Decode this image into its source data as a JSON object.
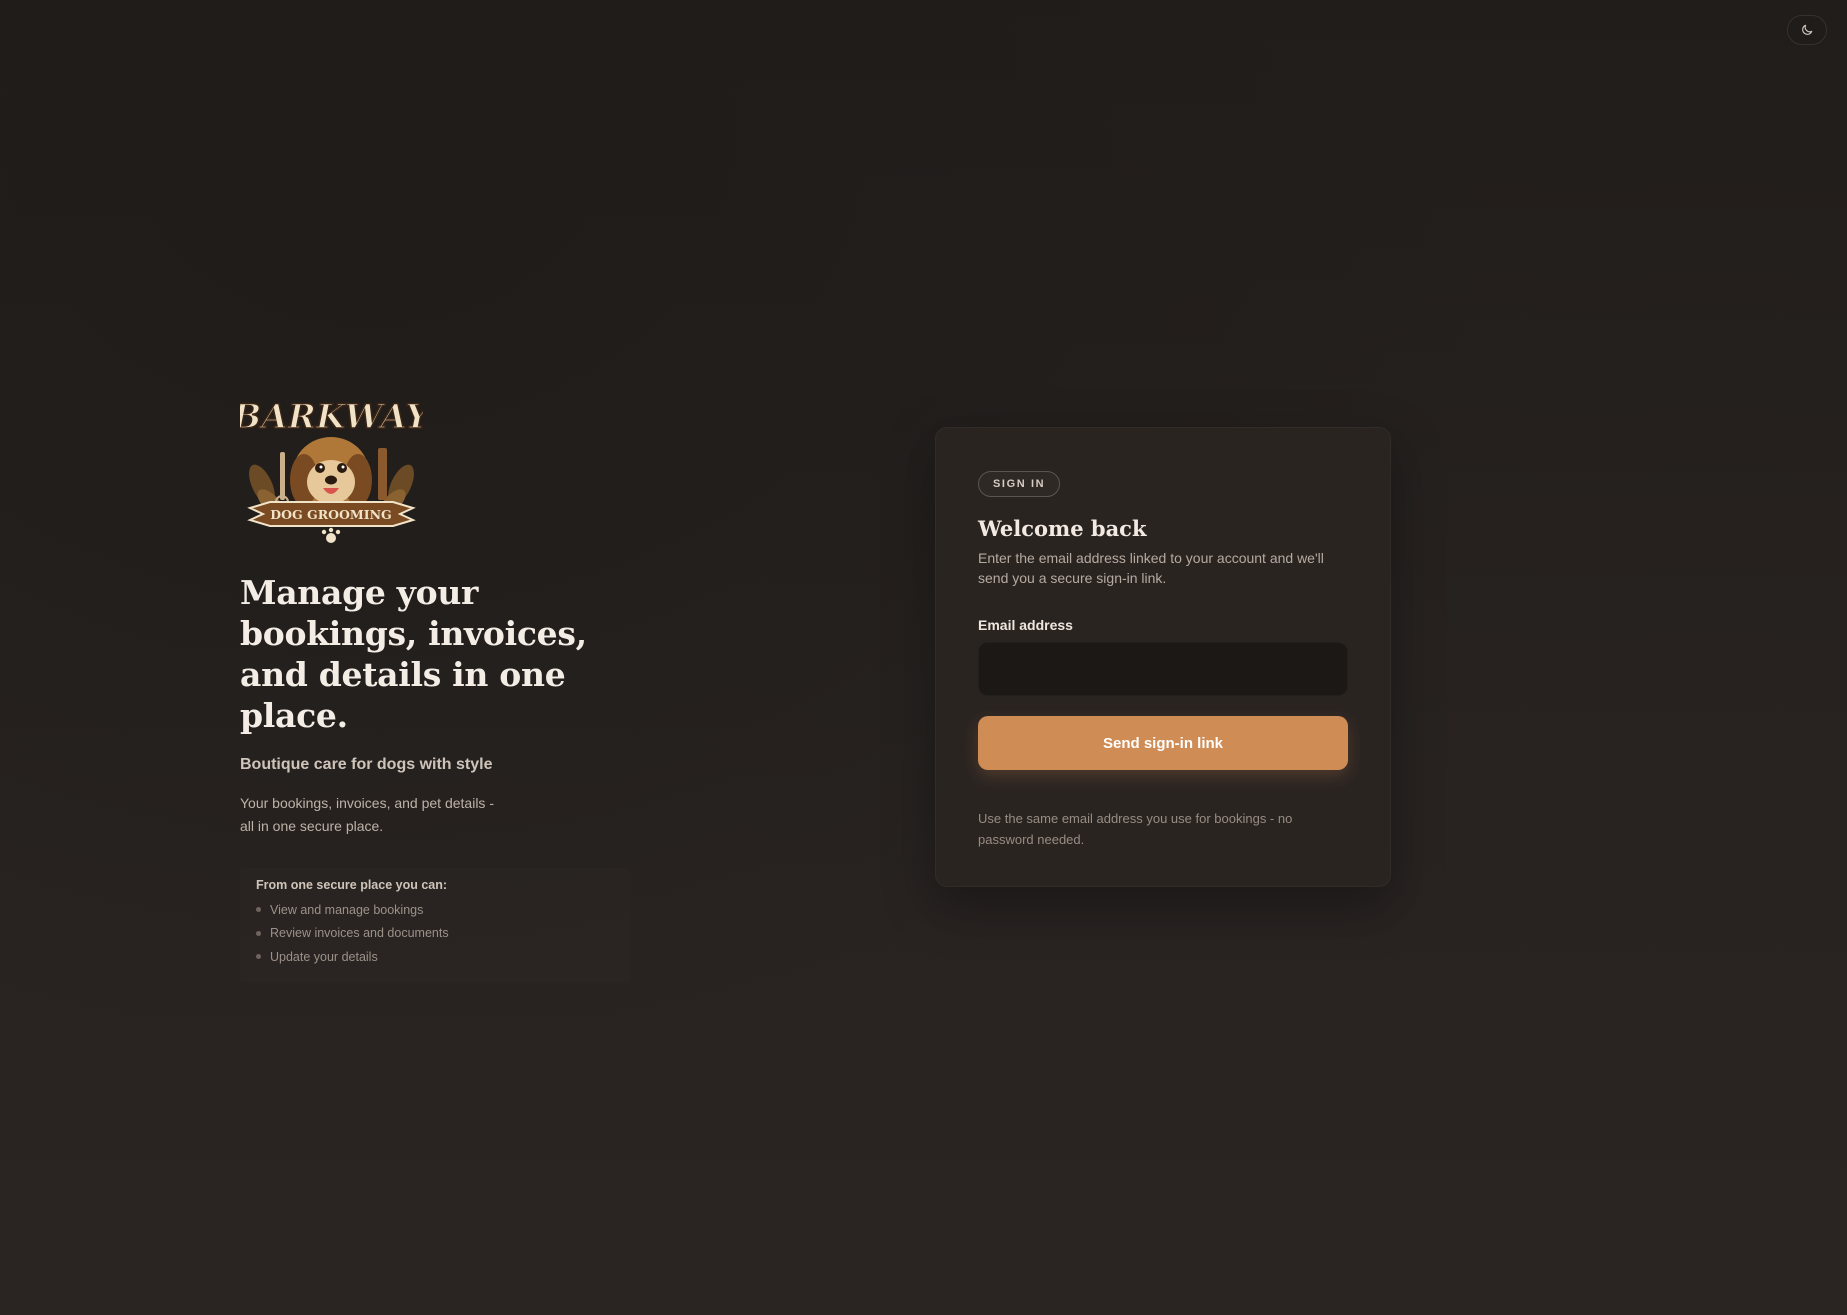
{
  "theme_toggle": {
    "icon": "moon-icon",
    "label": ""
  },
  "brand": {
    "logo_text_top": "BARKWAY",
    "logo_text_bottom": "DOG GROOMING",
    "colors": {
      "logo_brown": "#7a4a22",
      "logo_cream": "#f1e3c8"
    }
  },
  "hero": {
    "title": "Manage your bookings, invoices, and details in one place.",
    "tagline": "Boutique care for dogs with style",
    "description": "Your bookings, invoices, and pet details - all in one secure place.",
    "features_title": "From one secure place you can:",
    "features": [
      "View and manage bookings",
      "Review invoices and documents",
      "Update your details"
    ]
  },
  "signin": {
    "badge": "SIGN IN",
    "title": "Welcome back",
    "subtitle": "Enter the email address linked to your account and we'll send you a secure sign-in link.",
    "email_label": "Email address",
    "email_value": "",
    "email_placeholder": "",
    "submit_label": "Send sign-in link",
    "note": "Use the same email address you use for bookings - no password needed."
  },
  "colors": {
    "background": "#272220",
    "card": "#2a2421",
    "accent": "#d08c55",
    "input_bg": "#1b1816",
    "text_primary": "#f4ede6"
  }
}
